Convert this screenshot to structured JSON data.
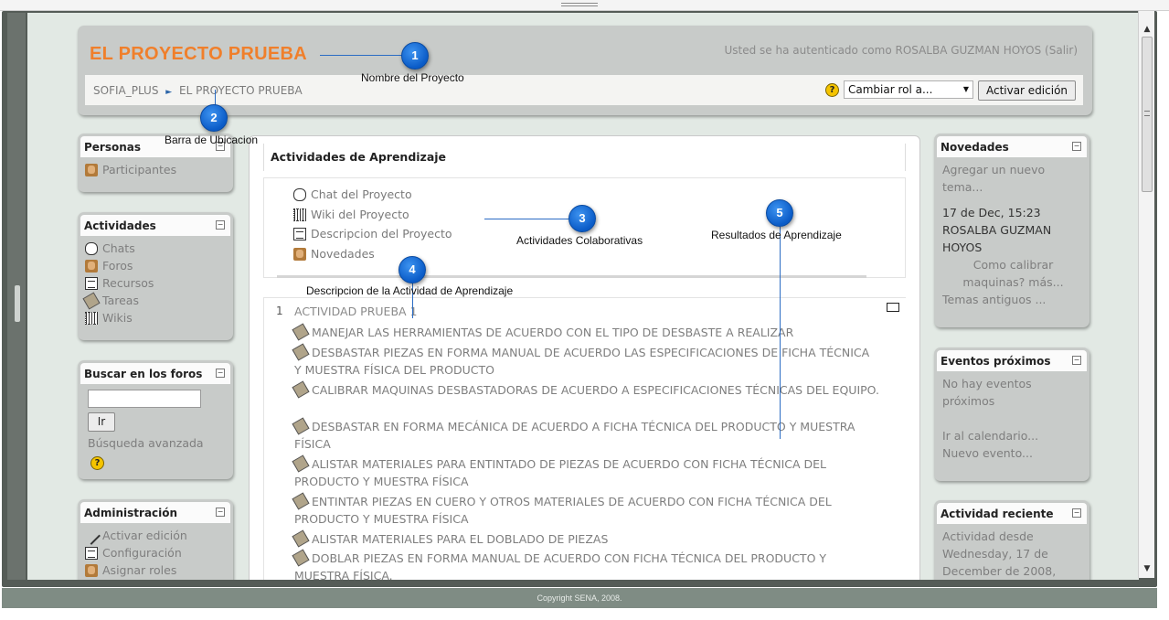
{
  "header": {
    "site_title": "EL PROYECTO PRUEBA",
    "login_info": "Usted se ha autenticado como ROSALBA GUZMAN HOYOS (Salir)",
    "breadcrumb": {
      "home": "SOFIA_PLUS",
      "separator": "►",
      "current": "EL PROYECTO PRUEBA"
    },
    "help_icon": "?",
    "role_select": {
      "value": "Cambiar rol a...",
      "arrow": "▼"
    },
    "edit_button": "Activar edición"
  },
  "left_blocks": {
    "personas": {
      "title": "Personas",
      "items": [
        "Participantes"
      ]
    },
    "actividades": {
      "title": "Actividades",
      "items": [
        "Chats",
        "Foros",
        "Recursos",
        "Tareas",
        "Wikis"
      ]
    },
    "buscar": {
      "title": "Buscar en los foros",
      "button": "Ir",
      "advanced": "Búsqueda avanzada",
      "help": "?"
    },
    "administracion": {
      "title": "Administración",
      "items": [
        "Activar edición",
        "Configuración",
        "Asignar roles"
      ]
    }
  },
  "center": {
    "title": "Actividades de Aprendizaje",
    "collab_items": [
      "Chat del Proyecto",
      "Wiki del Proyecto",
      "Descripcion del Proyecto",
      "Novedades"
    ],
    "topic": {
      "number": "1",
      "title": "ACTIVIDAD PRUEBA 1",
      "assignments": [
        "MANEJAR LAS HERRAMIENTAS DE ACUERDO CON EL TIPO DE DESBASTE A REALIZAR",
        "DESBASTAR PIEZAS EN FORMA MANUAL DE ACUERDO LAS ESPECIFICACIONES DE FICHA TÉCNICA Y MUESTRA FÍSICA DEL PRODUCTO",
        "CALIBRAR MAQUINAS DESBASTADORAS DE ACUERDO A ESPECIFICACIONES TÉCNICAS DEL EQUIPO.",
        "DESBASTAR EN FORMA MECÁNICA DE ACUERDO A FICHA TÉCNICA DEL PRODUCTO Y MUESTRA FÍSICA",
        "ALISTAR MATERIALES PARA ENTINTADO DE PIEZAS DE ACUERDO CON FICHA TÉCNICA DEL PRODUCTO Y MUESTRA FÍSICA",
        "ENTINTAR PIEZAS EN CUERO Y OTROS MATERIALES DE ACUERDO CON FICHA TÉCNICA DEL PRODUCTO Y MUESTRA FÍSICA",
        "ALISTAR MATERIALES PARA EL DOBLADO DE PIEZAS",
        "DOBLAR PIEZAS EN FORMA MANUAL DE ACUERDO CON FICHA TÉCNICA DEL PRODUCTO Y MUESTRA FÍSICA."
      ]
    }
  },
  "right_blocks": {
    "novedades": {
      "title": "Novedades",
      "add_topic": "Agregar un nuevo tema...",
      "date": "17 de Dec, 15:23",
      "author": "ROSALBA GUZMAN HOYOS",
      "post": "Como calibrar maquinas? más...",
      "older": "Temas antiguos ..."
    },
    "eventos": {
      "title": "Eventos próximos",
      "none": "No hay eventos próximos",
      "calendar": "Ir al calendario...",
      "new_event": "Nuevo evento..."
    },
    "reciente": {
      "title": "Actividad reciente",
      "since": "Actividad desde Wednesday, 17 de December de 2008,"
    }
  },
  "callouts": [
    {
      "number": "1",
      "label": "Nombre del Proyecto"
    },
    {
      "number": "2",
      "label": "Barra de Ubicacion"
    },
    {
      "number": "3",
      "label": "Actividades Colaborativas"
    },
    {
      "number": "4",
      "label": "Descripcion de la Actividad de Aprendizaje"
    },
    {
      "number": "5",
      "label": "Resultados de Aprendizaje"
    }
  ],
  "footer": "Copyright SENA, 2008.",
  "colors": {
    "site_title": "#f07f2b",
    "callout_blue": "#0a5bc7",
    "page_bg": "#e2e9e4",
    "panel_bg": "#c8cbc9"
  },
  "icons": {
    "collapse": "−",
    "scroll_up": "▲",
    "scroll_down": "▼"
  }
}
